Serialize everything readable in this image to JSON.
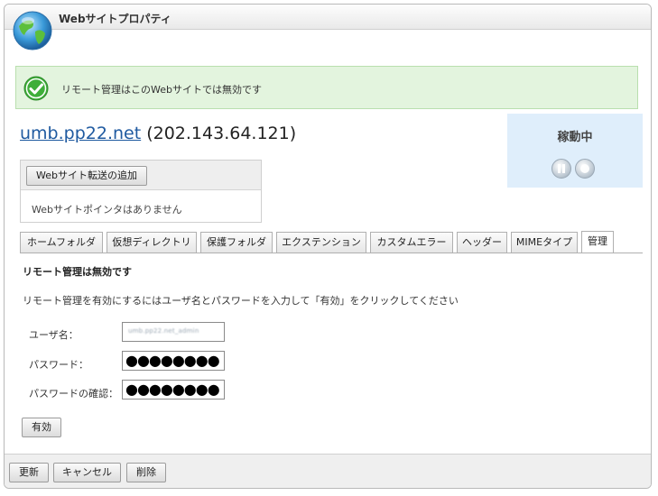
{
  "window": {
    "title": "Webサイトプロパティ"
  },
  "alert": {
    "message": "リモート管理はこのWebサイトでは無効です"
  },
  "site": {
    "domain": "umb.pp22.net",
    "ip": "(202.143.64.121)"
  },
  "status": {
    "label": "稼動中"
  },
  "redirect": {
    "add_button": "Webサイト転送の追加",
    "empty_text": "Webサイトポインタはありません"
  },
  "tabs": [
    {
      "label": "ホームフォルダ"
    },
    {
      "label": "仮想ディレクトリ"
    },
    {
      "label": "保護フォルダ"
    },
    {
      "label": "エクステンション"
    },
    {
      "label": "カスタムエラー"
    },
    {
      "label": "ヘッダー"
    },
    {
      "label": "MIMEタイプ"
    },
    {
      "label": "管理",
      "active": true
    }
  ],
  "remote": {
    "title": "リモート管理は無効です",
    "description": "リモート管理を有効にするにはユーザ名とパスワードを入力して「有効」をクリックしてください",
    "username_label": "ユーザ名：",
    "username_value": "umb.pp22.net_admin",
    "password_label": "パスワード：",
    "password_value": "●●●●●●●●",
    "confirm_label": "パスワードの確認：",
    "confirm_value": "●●●●●●●●",
    "enable_button": "有効"
  },
  "footer": {
    "update_button": "更新",
    "cancel_button": "キャンセル",
    "delete_button": "削除"
  }
}
